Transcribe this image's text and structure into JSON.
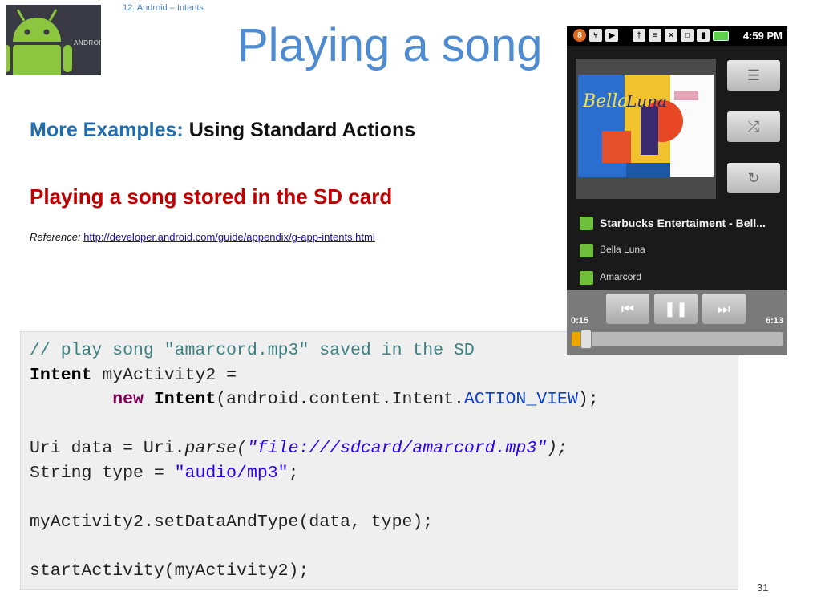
{
  "slide": {
    "breadcrumb": "12. Android – Intents",
    "title": "Playing a song",
    "subheading_blue": "More Examples:",
    "subheading_black": " Using Standard Actions",
    "red_heading": "Playing a song stored in the SD card",
    "reference_label": "Reference:",
    "reference_link": "http://developer.android.com/guide/appendix/g-app-intents.html",
    "page_number": "31",
    "logo_text": "ANDROID"
  },
  "code": {
    "comment": "// play song \"amarcord.mp3\" saved in the SD",
    "intent_kw": "Intent",
    "intent_decl_rest": " myActivity2 =",
    "new_kw": "new",
    "intent_kw2": "Intent",
    "intent_args": "(android.content.Intent.",
    "action_view": "ACTION_VIEW",
    "intent_close": ");",
    "uri_start": "Uri data = Uri.",
    "parse": "parse(",
    "uri_string": "\"file:///sdcard/amarcord.mp3\"",
    "uri_end": ");",
    "type_start": "String type = ",
    "type_string": "\"audio/mp3\"",
    "type_end": ";",
    "set_data": "myActivity2.setDataAndType(data, type);",
    "start_activity": "startActivity(myActivity2);"
  },
  "phone": {
    "status_time": "4:59 PM",
    "status_notification_count": "8",
    "track_artist": "Starbucks Entertaiment - Bell...",
    "track_album": "Bella Luna",
    "track_song": "Amarcord",
    "time_elapsed": "0:15",
    "time_total": "6:13",
    "progress_fraction": 0.04,
    "accent_color": "#f0a400",
    "icons": [
      "playlist-icon",
      "shuffle-icon",
      "repeat-icon",
      "previous-icon",
      "pause-icon",
      "next-icon"
    ]
  }
}
